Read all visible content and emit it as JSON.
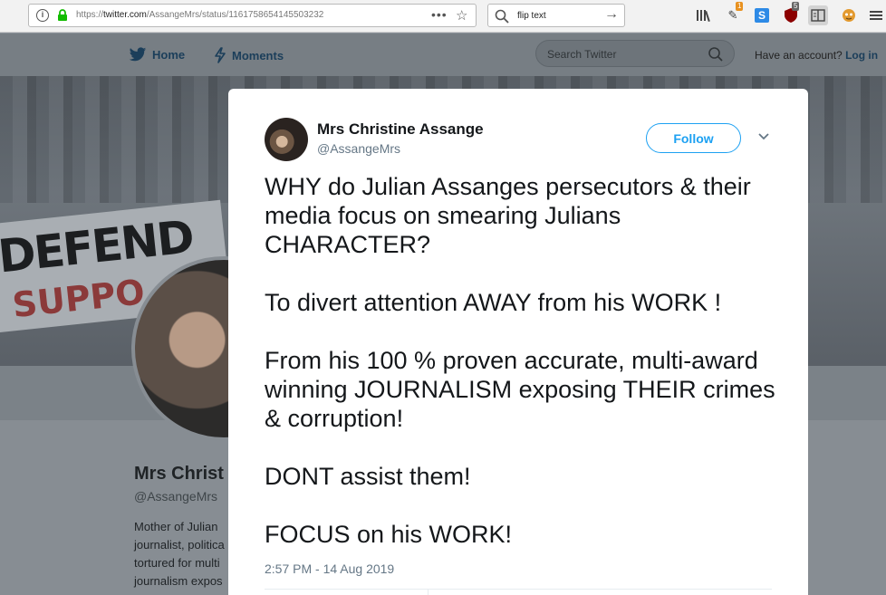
{
  "browser": {
    "url_prefix": "https://",
    "url_host": "twitter.com",
    "url_path": "/AssangeMrs/status/1161758654145503232",
    "search_value": "flip text",
    "badges": {
      "ext1": "1",
      "ublock": "5"
    }
  },
  "twitter_nav": {
    "home": "Home",
    "moments": "Moments",
    "search_placeholder": "Search Twitter",
    "have_account": "Have an account?",
    "login": "Log in"
  },
  "profile": {
    "name": "Mrs Christ",
    "handle": "@AssangeMrs",
    "bio": "Mother of Julian journalist, politica tortured for multi journalism expos",
    "banner_sign_top": "DEFEND",
    "banner_sign_bottom": "SUPPO"
  },
  "tweet": {
    "author_name": "Mrs Christine Assange",
    "author_handle": "@AssangeMrs",
    "follow_label": "Follow",
    "paragraphs": [
      "WHY do Julian Assanges persecutors & their media focus on smearing Julians CHARACTER?",
      "To divert attention AWAY from his WORK !",
      "From his 100 % proven accurate, multi-award winning JOURNALISM exposing THEIR crimes & corruption!",
      "DONT assist them!",
      "FOCUS on his WORK!"
    ],
    "timestamp": "2:57 PM - 14 Aug 2019"
  },
  "colors": {
    "twitter_blue": "#1da1f2",
    "text_primary": "#14171a",
    "text_secondary": "#657786"
  }
}
